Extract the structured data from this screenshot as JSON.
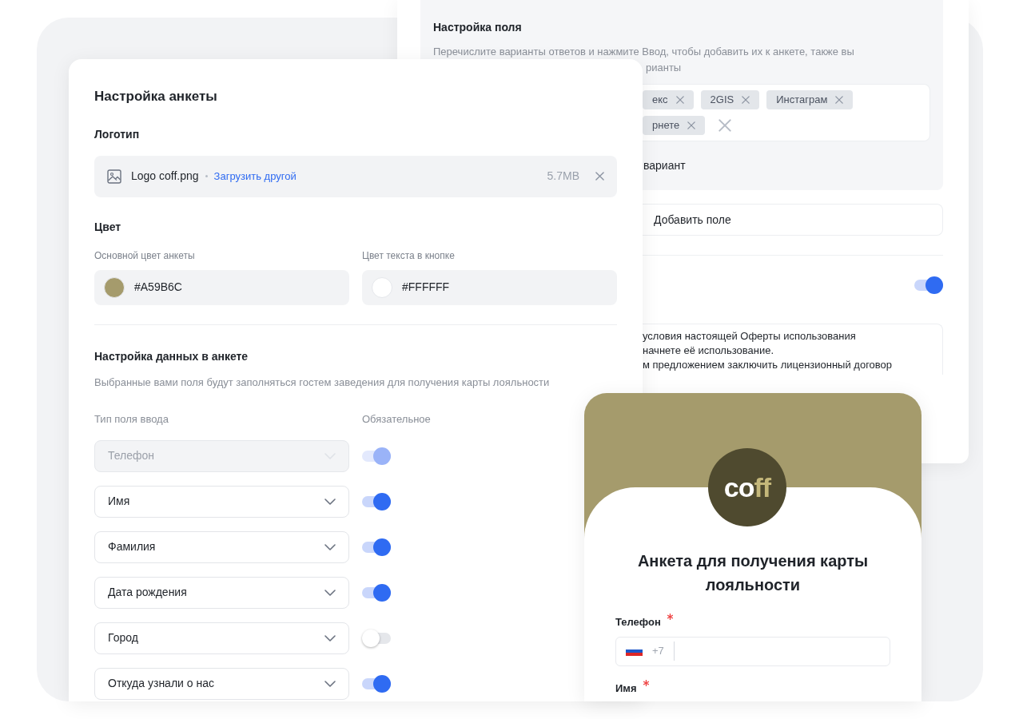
{
  "field_settings": {
    "title": "Настройка поля",
    "description_line_1": "Перечислите варианты ответов и нажмите Ввод, чтобы добавить их к анкете, также вы",
    "description_line_2": "рианты",
    "tag_rows": [
      [
        {
          "label": "екс"
        },
        {
          "label": "2GIS"
        },
        {
          "label": "Инстаграм"
        }
      ],
      [
        {
          "label": "рнете"
        }
      ]
    ],
    "option_text": "вариант",
    "add_field": "Добавить поле",
    "toggle_on": true,
    "offer_lines": [
      "условия настоящей Оферты использования",
      "начнете её использование.",
      "м предложением заключить лицензионный договор"
    ]
  },
  "form_settings": {
    "title": "Настройка анкеты",
    "logo_heading": "Логотип",
    "file_name": "Logo coff.png",
    "upload_link": "Загрузить другой",
    "file_size": "5.7MB",
    "color_heading": "Цвет",
    "colors": [
      {
        "label": "Основной цвет анкеты",
        "value": "#A59B6C",
        "color": "#a59b6c"
      },
      {
        "label": "Цвет текста в кнопке",
        "value": "#FFFFFF",
        "color": "#ffffff"
      }
    ],
    "data_heading": "Настройка данных в анкете",
    "data_description": "Выбранные вами поля будут заполняться гостем заведения для получения карты лояльности",
    "column_type": "Тип поля ввода",
    "column_required": "Обязательное",
    "rows": [
      {
        "label": "Телефон",
        "disabled": true,
        "required": true
      },
      {
        "label": "Имя",
        "disabled": false,
        "required": true
      },
      {
        "label": "Фамилия",
        "disabled": false,
        "required": true
      },
      {
        "label": "Дата рождения",
        "disabled": false,
        "required": true
      },
      {
        "label": "Город",
        "disabled": false,
        "required": false
      },
      {
        "label": "Откуда узнали о нас",
        "disabled": false,
        "required": true
      }
    ]
  },
  "preview": {
    "logo_light": "co",
    "logo_accent": "ff",
    "title": "Анкета для получения карты лояльности",
    "fields": [
      {
        "label": "Телефон",
        "required": true,
        "kind": "phone",
        "code": "+7"
      },
      {
        "label": "Имя",
        "required": true,
        "kind": "text"
      }
    ]
  }
}
